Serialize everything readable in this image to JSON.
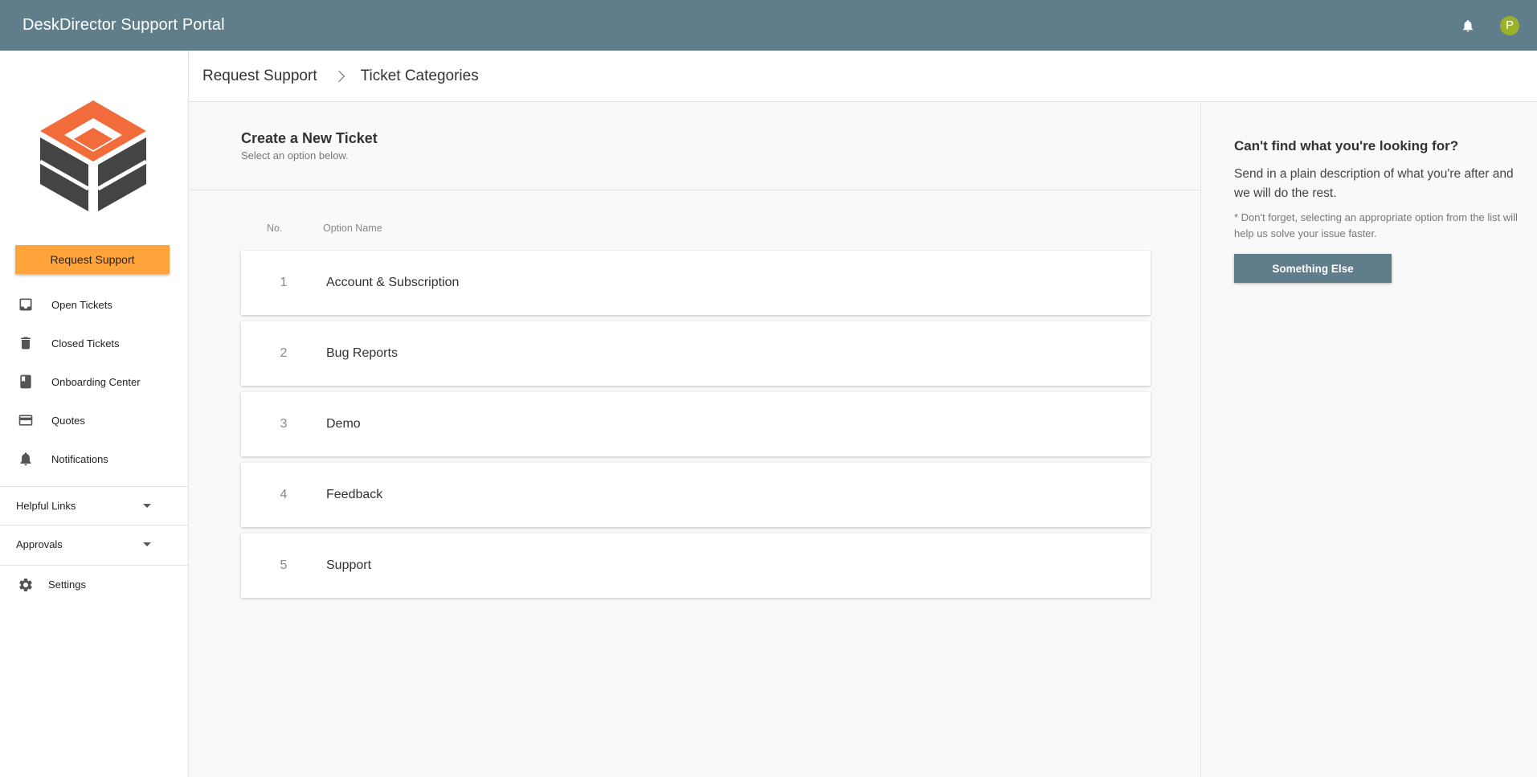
{
  "header": {
    "title": "DeskDirector Support Portal",
    "avatar_initial": "P",
    "bell_icon": "bell-icon"
  },
  "sidebar": {
    "logo_icon": "deskdirector-logo",
    "request_button": "Request Support",
    "items": [
      {
        "label": "Open Tickets",
        "icon": "inbox-icon"
      },
      {
        "label": "Closed Tickets",
        "icon": "trash-icon"
      },
      {
        "label": "Onboarding Center",
        "icon": "book-icon"
      },
      {
        "label": "Quotes",
        "icon": "credit-card-icon"
      },
      {
        "label": "Notifications",
        "icon": "bell-icon"
      }
    ],
    "helpful_links": "Helpful Links",
    "approvals": "Approvals",
    "settings": "Settings"
  },
  "breadcrumb": {
    "items": [
      "Request Support",
      "Ticket Categories"
    ]
  },
  "main": {
    "title": "Create a New Ticket",
    "subtitle": "Select an option below.",
    "col_no": "No.",
    "col_name": "Option Name",
    "options": [
      {
        "no": "1",
        "name": "Account & Subscription"
      },
      {
        "no": "2",
        "name": "Bug Reports"
      },
      {
        "no": "3",
        "name": "Demo"
      },
      {
        "no": "4",
        "name": "Feedback"
      },
      {
        "no": "5",
        "name": "Support"
      }
    ]
  },
  "side_panel": {
    "title": "Can't find what you're looking for?",
    "description": "Send in a plain description of what you're after and we will do the rest.",
    "note": "* Don't forget, selecting an appropriate option from the list will help us solve your issue faster.",
    "button": "Something Else"
  },
  "colors": {
    "header_bg": "#607d8b",
    "accent_orange": "#ffa43a",
    "logo_orange": "#f26b3a",
    "logo_dark": "#444444",
    "avatar_bg": "#9cb02a"
  }
}
